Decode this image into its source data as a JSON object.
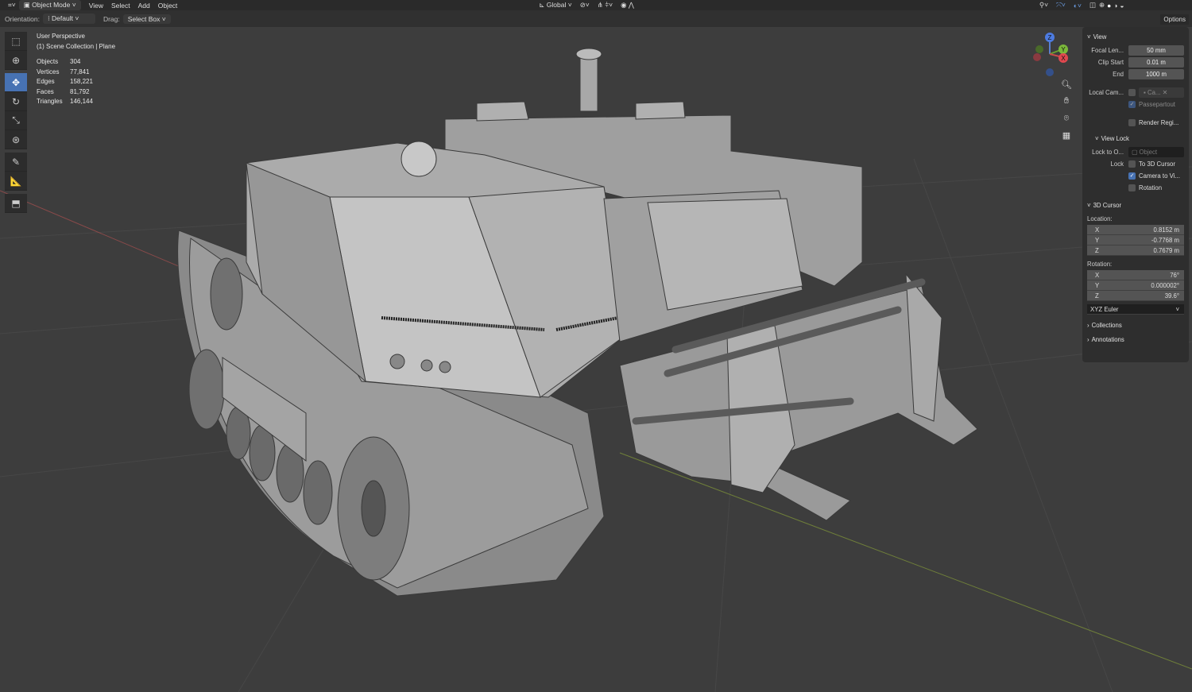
{
  "header": {
    "mode": "Object Mode",
    "menus": [
      "View",
      "Select",
      "Add",
      "Object"
    ],
    "transform_orientation": "Global",
    "options_label": "Options"
  },
  "toolsettings": {
    "orientation_label": "Orientation:",
    "orientation_value": "Default",
    "drag_label": "Drag:",
    "drag_value": "Select Box"
  },
  "overlay": {
    "view_name": "User Perspective",
    "collection": "(1) Scene Collection | Plane",
    "stats": [
      {
        "label": "Objects",
        "value": "304"
      },
      {
        "label": "Vertices",
        "value": "77,841"
      },
      {
        "label": "Edges",
        "value": "158,221"
      },
      {
        "label": "Faces",
        "value": "81,792"
      },
      {
        "label": "Triangles",
        "value": "146,144"
      }
    ]
  },
  "gizmo": {
    "z": "Z",
    "y": "Y",
    "x": "X"
  },
  "npanel": {
    "view": {
      "title": "View",
      "focal_label": "Focal Len...",
      "focal": "50 mm",
      "clip_start_label": "Clip Start",
      "clip_start": "0.01 m",
      "end_label": "End",
      "end": "1000 m",
      "local_cam_label": "Local Cam...",
      "local_cam_value": "Ca...",
      "passepartout": "Passepartout",
      "render_region": "Render Regi..."
    },
    "view_lock": {
      "title": "View Lock",
      "lock_to_label": "Lock to O...",
      "lock_to_placeholder": "Object",
      "lock_label": "Lock",
      "to_cursor": "To 3D Cursor",
      "camera_to_view": "Camera to Vi...",
      "rotation": "Rotation"
    },
    "cursor": {
      "title": "3D Cursor",
      "location_label": "Location:",
      "location": [
        {
          "axis": "X",
          "value": "0.8152 m"
        },
        {
          "axis": "Y",
          "value": "-0.7768 m"
        },
        {
          "axis": "Z",
          "value": "0.7679 m"
        }
      ],
      "rotation_label": "Rotation:",
      "rotation": [
        {
          "axis": "X",
          "value": "76°"
        },
        {
          "axis": "Y",
          "value": "0.000002°"
        },
        {
          "axis": "Z",
          "value": "39.6°"
        }
      ],
      "rotation_mode": "XYZ Euler"
    },
    "collections": "Collections",
    "annotations": "Annotations"
  }
}
